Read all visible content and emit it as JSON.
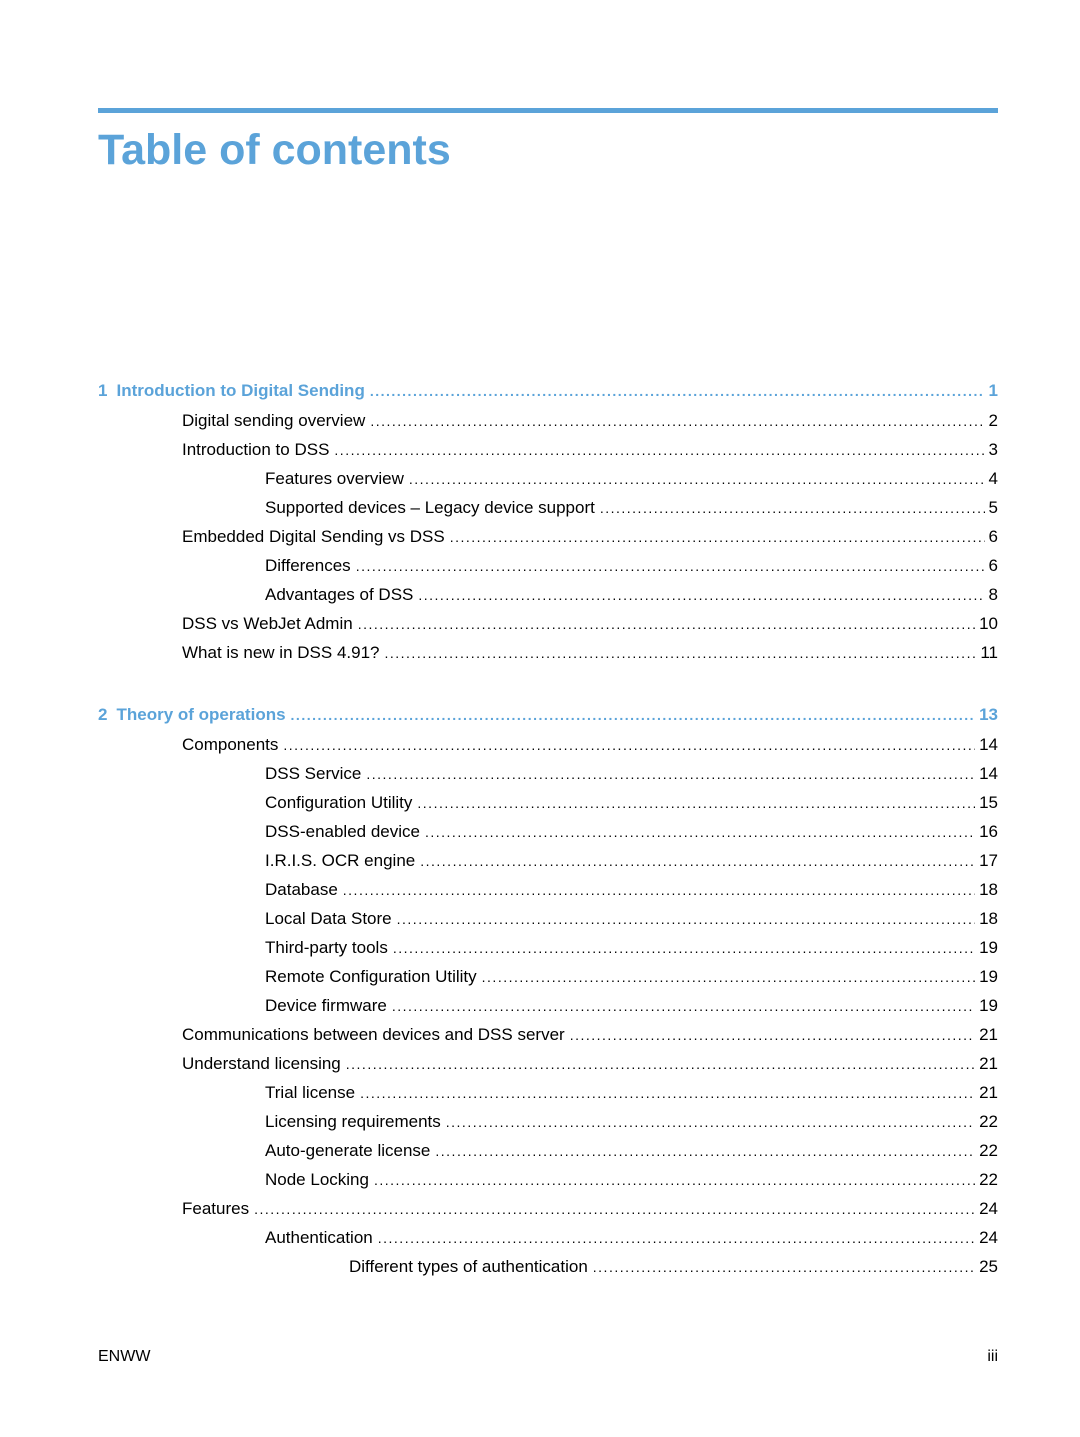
{
  "header": {
    "title": "Table of contents",
    "accent_color": "#5ba3d9"
  },
  "toc": {
    "chapters": [
      {
        "number": "1",
        "title": "Introduction to Digital Sending",
        "page": "1",
        "entries": [
          {
            "level": 1,
            "title": "Digital sending overview",
            "page": "2"
          },
          {
            "level": 1,
            "title": "Introduction to DSS",
            "page": "3"
          },
          {
            "level": 2,
            "title": "Features overview",
            "page": "4"
          },
          {
            "level": 2,
            "title": "Supported devices – Legacy device support",
            "page": "5"
          },
          {
            "level": 1,
            "title": "Embedded Digital Sending vs DSS",
            "page": "6"
          },
          {
            "level": 2,
            "title": "Differences",
            "page": "6"
          },
          {
            "level": 2,
            "title": "Advantages of DSS",
            "page": "8"
          },
          {
            "level": 1,
            "title": "DSS vs WebJet Admin",
            "page": "10"
          },
          {
            "level": 1,
            "title": "What is new in DSS 4.91?",
            "page": "11"
          }
        ]
      },
      {
        "number": "2",
        "title": "Theory of operations",
        "page": "13",
        "entries": [
          {
            "level": 1,
            "title": "Components",
            "page": "14"
          },
          {
            "level": 2,
            "title": "DSS Service",
            "page": "14"
          },
          {
            "level": 2,
            "title": "Configuration Utility",
            "page": "15"
          },
          {
            "level": 2,
            "title": "DSS-enabled device",
            "page": "16"
          },
          {
            "level": 2,
            "title": "I.R.I.S. OCR engine",
            "page": "17"
          },
          {
            "level": 2,
            "title": "Database",
            "page": "18"
          },
          {
            "level": 2,
            "title": "Local Data Store",
            "page": "18"
          },
          {
            "level": 2,
            "title": "Third-party tools",
            "page": "19"
          },
          {
            "level": 2,
            "title": "Remote Configuration Utility",
            "page": "19"
          },
          {
            "level": 2,
            "title": "Device firmware",
            "page": "19"
          },
          {
            "level": 1,
            "title": "Communications between devices and DSS server",
            "page": "21"
          },
          {
            "level": 1,
            "title": "Understand licensing",
            "page": "21"
          },
          {
            "level": 2,
            "title": "Trial license",
            "page": "21"
          },
          {
            "level": 2,
            "title": "Licensing requirements",
            "page": "22"
          },
          {
            "level": 2,
            "title": "Auto-generate license",
            "page": "22"
          },
          {
            "level": 2,
            "title": "Node Locking",
            "page": "22"
          },
          {
            "level": 1,
            "title": "Features",
            "page": "24"
          },
          {
            "level": 2,
            "title": "Authentication",
            "page": "24"
          },
          {
            "level": 3,
            "title": "Different types of authentication",
            "page": "25"
          }
        ]
      }
    ]
  },
  "footer": {
    "left": "ENWW",
    "right": "iii"
  }
}
